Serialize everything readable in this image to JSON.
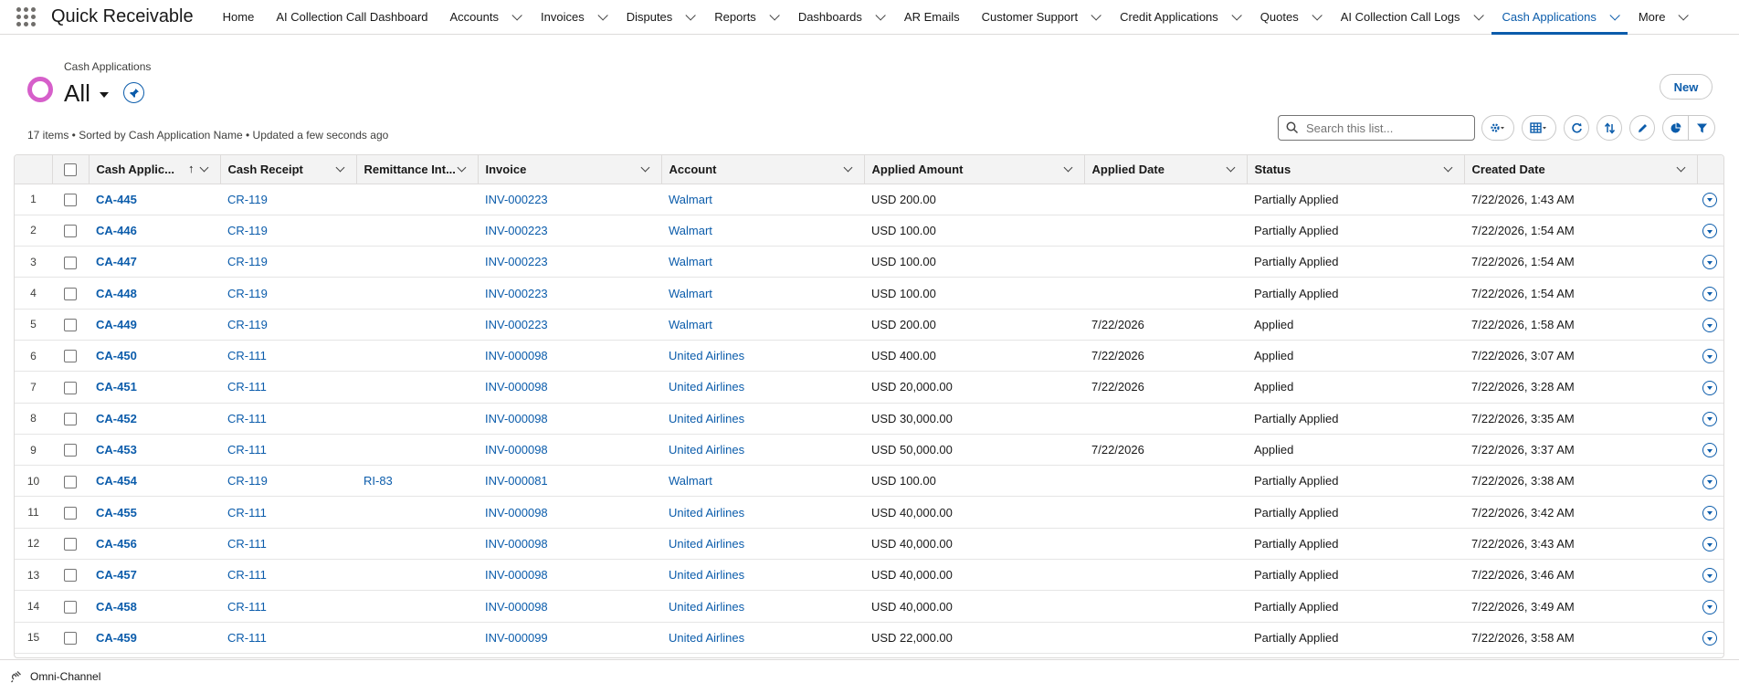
{
  "app": {
    "name": "Quick Receivable"
  },
  "nav": [
    {
      "label": "Home",
      "has_menu": false
    },
    {
      "label": "AI Collection Call Dashboard",
      "has_menu": false
    },
    {
      "label": "Accounts",
      "has_menu": true
    },
    {
      "label": "Invoices",
      "has_menu": true
    },
    {
      "label": "Disputes",
      "has_menu": true
    },
    {
      "label": "Reports",
      "has_menu": true
    },
    {
      "label": "Dashboards",
      "has_menu": true
    },
    {
      "label": "AR Emails",
      "has_menu": false
    },
    {
      "label": "Customer Support",
      "has_menu": true
    },
    {
      "label": "Credit Applications",
      "has_menu": true
    },
    {
      "label": "Quotes",
      "has_menu": true
    },
    {
      "label": "AI Collection Call Logs",
      "has_menu": true
    },
    {
      "label": "Cash Applications",
      "has_menu": true,
      "active": true
    },
    {
      "label": "More",
      "has_menu": true
    }
  ],
  "header": {
    "object_label": "Cash Applications",
    "list_view": "All",
    "new_button": "New",
    "summary": "17 items • Sorted by Cash Application Name • Updated a few seconds ago"
  },
  "search": {
    "placeholder": "Search this list..."
  },
  "columns": [
    {
      "key": "name",
      "label": "Cash Applic...",
      "sorted": "asc"
    },
    {
      "key": "receipt",
      "label": "Cash Receipt"
    },
    {
      "key": "remit",
      "label": "Remittance Int..."
    },
    {
      "key": "invoice",
      "label": "Invoice"
    },
    {
      "key": "account",
      "label": "Account"
    },
    {
      "key": "amount",
      "label": "Applied Amount"
    },
    {
      "key": "applied_date",
      "label": "Applied Date"
    },
    {
      "key": "status",
      "label": "Status"
    },
    {
      "key": "created",
      "label": "Created Date"
    }
  ],
  "rows": [
    {
      "n": "1",
      "name": "CA-445",
      "receipt": "CR-119",
      "remit": "",
      "invoice": "INV-000223",
      "account": "Walmart",
      "amount": "USD 200.00",
      "applied_date": "",
      "status": "Partially Applied",
      "created": "7/22/2026, 1:43 AM"
    },
    {
      "n": "2",
      "name": "CA-446",
      "receipt": "CR-119",
      "remit": "",
      "invoice": "INV-000223",
      "account": "Walmart",
      "amount": "USD 100.00",
      "applied_date": "",
      "status": "Partially Applied",
      "created": "7/22/2026, 1:54 AM"
    },
    {
      "n": "3",
      "name": "CA-447",
      "receipt": "CR-119",
      "remit": "",
      "invoice": "INV-000223",
      "account": "Walmart",
      "amount": "USD 100.00",
      "applied_date": "",
      "status": "Partially Applied",
      "created": "7/22/2026, 1:54 AM"
    },
    {
      "n": "4",
      "name": "CA-448",
      "receipt": "CR-119",
      "remit": "",
      "invoice": "INV-000223",
      "account": "Walmart",
      "amount": "USD 100.00",
      "applied_date": "",
      "status": "Partially Applied",
      "created": "7/22/2026, 1:54 AM"
    },
    {
      "n": "5",
      "name": "CA-449",
      "receipt": "CR-119",
      "remit": "",
      "invoice": "INV-000223",
      "account": "Walmart",
      "amount": "USD 200.00",
      "applied_date": "7/22/2026",
      "status": "Applied",
      "created": "7/22/2026, 1:58 AM"
    },
    {
      "n": "6",
      "name": "CA-450",
      "receipt": "CR-111",
      "remit": "",
      "invoice": "INV-000098",
      "account": "United Airlines",
      "amount": "USD 400.00",
      "applied_date": "7/22/2026",
      "status": "Applied",
      "created": "7/22/2026, 3:07 AM"
    },
    {
      "n": "7",
      "name": "CA-451",
      "receipt": "CR-111",
      "remit": "",
      "invoice": "INV-000098",
      "account": "United Airlines",
      "amount": "USD 20,000.00",
      "applied_date": "7/22/2026",
      "status": "Applied",
      "created": "7/22/2026, 3:28 AM"
    },
    {
      "n": "8",
      "name": "CA-452",
      "receipt": "CR-111",
      "remit": "",
      "invoice": "INV-000098",
      "account": "United Airlines",
      "amount": "USD 30,000.00",
      "applied_date": "",
      "status": "Partially Applied",
      "created": "7/22/2026, 3:35 AM"
    },
    {
      "n": "9",
      "name": "CA-453",
      "receipt": "CR-111",
      "remit": "",
      "invoice": "INV-000098",
      "account": "United Airlines",
      "amount": "USD 50,000.00",
      "applied_date": "7/22/2026",
      "status": "Applied",
      "created": "7/22/2026, 3:37 AM"
    },
    {
      "n": "10",
      "name": "CA-454",
      "receipt": "CR-119",
      "remit": "RI-83",
      "invoice": "INV-000081",
      "account": "Walmart",
      "amount": "USD 100.00",
      "applied_date": "",
      "status": "Partially Applied",
      "created": "7/22/2026, 3:38 AM"
    },
    {
      "n": "11",
      "name": "CA-455",
      "receipt": "CR-111",
      "remit": "",
      "invoice": "INV-000098",
      "account": "United Airlines",
      "amount": "USD 40,000.00",
      "applied_date": "",
      "status": "Partially Applied",
      "created": "7/22/2026, 3:42 AM"
    },
    {
      "n": "12",
      "name": "CA-456",
      "receipt": "CR-111",
      "remit": "",
      "invoice": "INV-000098",
      "account": "United Airlines",
      "amount": "USD 40,000.00",
      "applied_date": "",
      "status": "Partially Applied",
      "created": "7/22/2026, 3:43 AM"
    },
    {
      "n": "13",
      "name": "CA-457",
      "receipt": "CR-111",
      "remit": "",
      "invoice": "INV-000098",
      "account": "United Airlines",
      "amount": "USD 40,000.00",
      "applied_date": "",
      "status": "Partially Applied",
      "created": "7/22/2026, 3:46 AM"
    },
    {
      "n": "14",
      "name": "CA-458",
      "receipt": "CR-111",
      "remit": "",
      "invoice": "INV-000098",
      "account": "United Airlines",
      "amount": "USD 40,000.00",
      "applied_date": "",
      "status": "Partially Applied",
      "created": "7/22/2026, 3:49 AM"
    },
    {
      "n": "15",
      "name": "CA-459",
      "receipt": "CR-111",
      "remit": "",
      "invoice": "INV-000099",
      "account": "United Airlines",
      "amount": "USD 22,000.00",
      "applied_date": "",
      "status": "Partially Applied",
      "created": "7/22/2026, 3:58 AM"
    }
  ],
  "footer": {
    "label": "Omni-Channel"
  },
  "colors": {
    "brand": "#0b5cab",
    "icon": "#d65fca",
    "border": "#dddbda"
  }
}
